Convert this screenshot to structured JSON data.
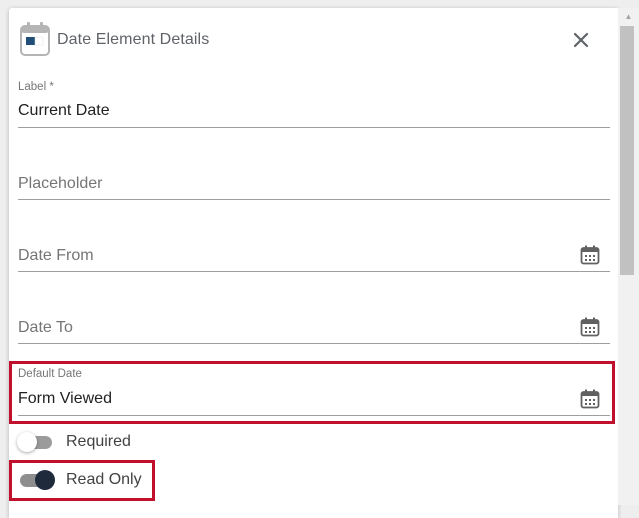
{
  "dialog": {
    "title": "Date Element Details",
    "header_icon": "calendar-icon",
    "close_icon": "close-icon"
  },
  "fields": {
    "label": {
      "label": "Label *",
      "value": "Current Date"
    },
    "placeholder": {
      "placeholder": "Placeholder"
    },
    "date_from": {
      "placeholder": "Date From",
      "icon": "calendar-icon"
    },
    "date_to": {
      "placeholder": "Date To",
      "icon": "calendar-icon"
    },
    "default_date": {
      "label": "Default Date",
      "value": "Form Viewed",
      "icon": "calendar-icon"
    }
  },
  "toggles": {
    "required": {
      "label": "Required",
      "checked": false
    },
    "read_only": {
      "label": "Read Only",
      "checked": true
    }
  },
  "colors": {
    "highlight": "#c0102b",
    "toggle_on": "#1f2a3c",
    "icon_blue": "#1f4e79"
  }
}
